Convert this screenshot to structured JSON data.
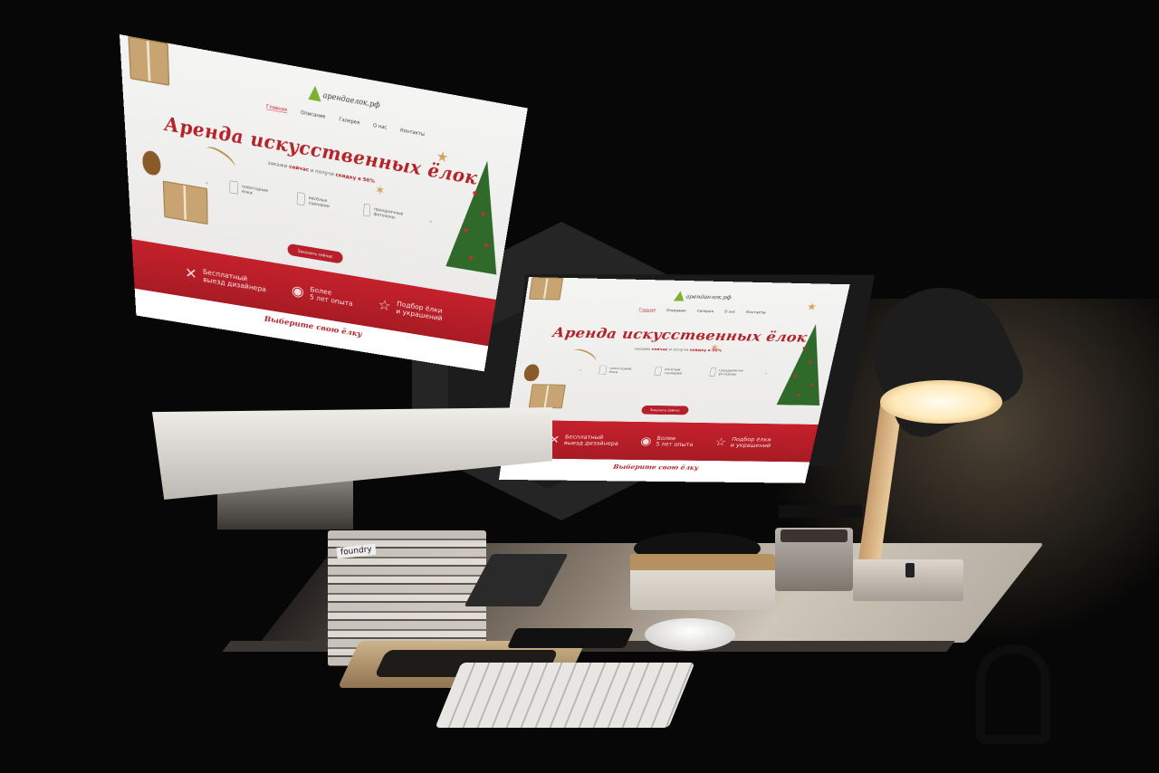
{
  "site": {
    "logo_text": "арендаелок.рф",
    "nav": [
      "Главная",
      "Описание",
      "Галерея",
      "О нас",
      "Контакты"
    ],
    "hero_title": "Аренда искусственных ёлок",
    "subtitle_pre": "закажи",
    "subtitle_now": "сейчас",
    "subtitle_mid": "и получи",
    "subtitle_discount": "скидку в 50%",
    "features": [
      "новогодние ёлки",
      "весёлые сценарии",
      "праздничные фотозоны"
    ],
    "cta_label": "Заказать сейчас",
    "band_items": [
      {
        "icon": "pencil-ruler-icon",
        "line1": "Бесплатный",
        "line2": "выезд дизайнера"
      },
      {
        "icon": "medal-icon",
        "line1": "Более",
        "line2": "5 лет опыта"
      },
      {
        "icon": "star-icon",
        "line1": "Подбор ёлки",
        "line2": "и украшений"
      }
    ],
    "section_title": "Выберите свою ёлку"
  },
  "desk": {
    "book_label": "foundry"
  },
  "colors": {
    "brand_red": "#b5202a",
    "band_red": "#c4212c",
    "logo_green": "#7cb22e",
    "lamp_light": "#ffe9b8"
  }
}
